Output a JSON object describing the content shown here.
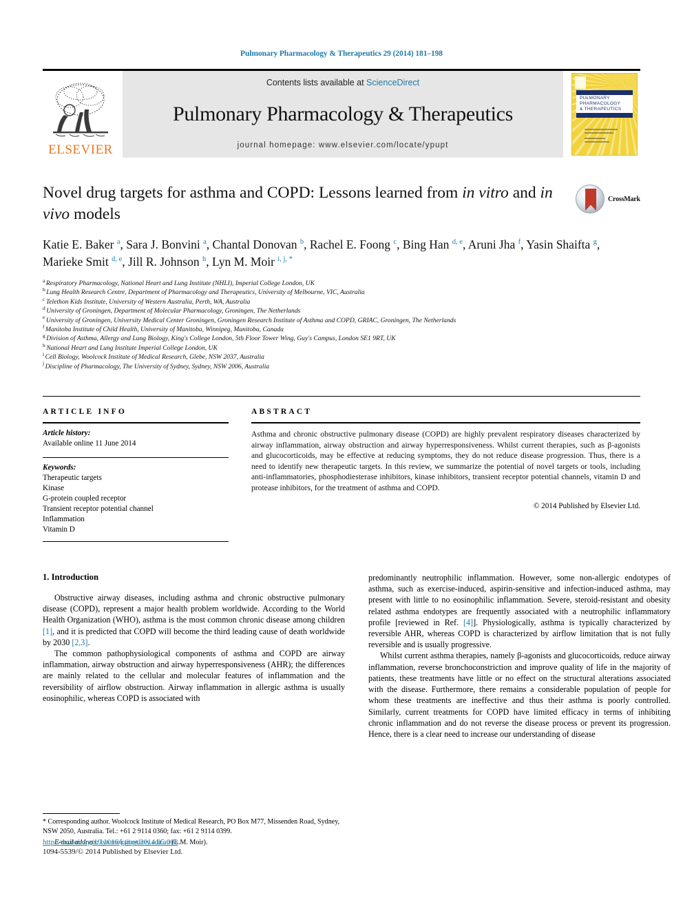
{
  "running_head": "Pulmonary Pharmacology & Therapeutics 29 (2014) 181–198",
  "masthead": {
    "contents_prefix": "Contents lists available at ",
    "sciencedirect": "ScienceDirect",
    "journal_title": "Pulmonary Pharmacology & Therapeutics",
    "homepage": "journal homepage: www.elsevier.com/locate/ypupt",
    "elsevier_wordmark": "ELSEVIER",
    "cover": {
      "line1": "PULMONARY",
      "line2": "PHARMACOLOGY",
      "line3": "& THERAPEUTICS"
    },
    "colors": {
      "link": "#1f7ba8",
      "elsevier_orange": "#e87722",
      "band_gray": "#e6e6e6",
      "cover_yellow": "#f2d33c",
      "cover_navy": "#1b2f6b"
    }
  },
  "article": {
    "title_part1": "Novel drug targets for asthma and COPD: Lessons learned from ",
    "title_italic1": "in vitro",
    "title_part2": " and ",
    "title_italic2": "in vivo",
    "title_part3": " models",
    "crossmark_label": "CrossMark",
    "authors": [
      {
        "name": "Katie E. Baker",
        "sup": "a",
        "sep": ", "
      },
      {
        "name": "Sara J. Bonvini",
        "sup": "a",
        "sep": ", "
      },
      {
        "name": "Chantal Donovan",
        "sup": "b",
        "sep": ", "
      },
      {
        "name": "Rachel E. Foong",
        "sup": "c",
        "sep": ", "
      },
      {
        "name": "Bing Han",
        "sup": "d, e",
        "sep": ", "
      },
      {
        "name": "Aruni Jha",
        "sup": "f",
        "sep": ", "
      },
      {
        "name": "Yasin Shaifta",
        "sup": "g",
        "sep": ", "
      },
      {
        "name": "Marieke Smit",
        "sup": "d, e",
        "sep": ", "
      },
      {
        "name": "Jill R. Johnson",
        "sup": "h",
        "sep": ", "
      },
      {
        "name": "Lyn M. Moir",
        "sup": "i, j, *",
        "sep": ""
      }
    ],
    "affiliations": [
      {
        "mark": "a",
        "text": "Respiratory Pharmacology, National Heart and Lung Institute (NHLI), Imperial College London, UK"
      },
      {
        "mark": "b",
        "text": "Lung Health Research Centre, Department of Pharmacology and Therapeutics, University of Melbourne, VIC, Australia"
      },
      {
        "mark": "c",
        "text": "Telethon Kids Institute, University of Western Australia, Perth, WA, Australia"
      },
      {
        "mark": "d",
        "text": "University of Groningen, Department of Molecular Pharmacology, Groningen, The Netherlands"
      },
      {
        "mark": "e",
        "text": "University of Groningen, University Medical Center Groningen, Groningen Research Institute of Asthma and COPD, GRIAC, Groningen, The Netherlands"
      },
      {
        "mark": "f",
        "text": "Manitoba Institute of Child Health, University of Manitoba, Winnipeg, Manitoba, Canada"
      },
      {
        "mark": "g",
        "text": "Division of Asthma, Allergy and Lung Biology, King's College London, 5th Floor Tower Wing, Guy's Campus, London SE1 9RT, UK"
      },
      {
        "mark": "h",
        "text": "National Heart and Lung Institute Imperial College London, UK"
      },
      {
        "mark": "i",
        "text": "Cell Biology, Woolcock Institute of Medical Research, Glebe, NSW 2037, Australia"
      },
      {
        "mark": "j",
        "text": "Discipline of Pharmacology, The University of Sydney, Sydney, NSW 2006, Australia"
      }
    ]
  },
  "article_info": {
    "heading": "ARTICLE INFO",
    "history_label": "Article history:",
    "history_value": "Available online 11 June 2014",
    "keywords_label": "Keywords:",
    "keywords": [
      "Therapeutic targets",
      "Kinase",
      "G-protein coupled receptor",
      "Transient receptor potential channel",
      "Inflammation",
      "Vitamin D"
    ]
  },
  "abstract": {
    "heading": "ABSTRACT",
    "text": "Asthma and chronic obstructive pulmonary disease (COPD) are highly prevalent respiratory diseases characterized by airway inflammation, airway obstruction and airway hyperresponsiveness. Whilst current therapies, such as β-agonists and glucocorticoids, may be effective at reducing symptoms, they do not reduce disease progression. Thus, there is a need to identify new therapeutic targets. In this review, we summarize the potential of novel targets or tools, including anti-inflammatories, phosphodiesterase inhibitors, kinase inhibitors, transient receptor potential channels, vitamin D and protease inhibitors, for the treatment of asthma and COPD.",
    "copyright": "© 2014 Published by Elsevier Ltd."
  },
  "body": {
    "section_number_title": "1. Introduction",
    "left_paragraphs": [
      {
        "segments": [
          {
            "t": "Obstructive airway diseases, including asthma and chronic obstructive pulmonary disease (COPD), represent a major health problem worldwide. According to the World Health Organization (WHO), asthma is the most common chronic disease among children "
          },
          {
            "t": "[1]",
            "ref": true
          },
          {
            "t": ", and it is predicted that COPD will become the third leading cause of death worldwide by 2030 "
          },
          {
            "t": "[2,3]",
            "ref": true
          },
          {
            "t": "."
          }
        ]
      },
      {
        "segments": [
          {
            "t": "The common pathophysiological components of asthma and COPD are airway inflammation, airway obstruction and airway hyperresponsiveness (AHR); the differences are mainly related to the cellular and molecular features of inflammation and the reversibility of airflow obstruction. Airway inflammation in allergic asthma is usually eosinophilic, whereas COPD is associated with"
          }
        ]
      }
    ],
    "right_paragraphs": [
      {
        "no_indent": true,
        "segments": [
          {
            "t": "predominantly neutrophilic inflammation. However, some non-allergic endotypes of asthma, such as exercise-induced, aspirin-sensitive and infection-induced asthma, may present with little to no eosinophilic inflammation. Severe, steroid-resistant and obesity related asthma endotypes are frequently associated with a neutrophilic inflammatory profile [reviewed in Ref. "
          },
          {
            "t": "[4]",
            "ref": true
          },
          {
            "t": "]. Physiologically, asthma is typically characterized by reversible AHR, whereas COPD is characterized by airflow limitation that is not fully reversible and is usually progressive."
          }
        ]
      },
      {
        "segments": [
          {
            "t": "Whilst current asthma therapies, namely β-agonists and glucocorticoids, reduce airway inflammation, reverse bronchoconstriction and improve quality of life in the majority of patients, these treatments have little or no effect on the structural alterations associated with the disease. Furthermore, there remains a considerable population of people for whom these treatments are ineffective and thus their asthma is poorly controlled. Similarly, current treatments for COPD have limited efficacy in terms of inhibiting chronic inflammation and do not reverse the disease process or prevent its progression. Hence, there is a clear need to increase our understanding of disease"
          }
        ]
      }
    ]
  },
  "footnote": {
    "star": "*",
    "text": " Corresponding author. Woolcock Institute of Medical Research, PO Box M77, Missenden Road, Sydney, NSW 2050, Australia. Tel.: +61 2 9114 0360; fax: +61 2 9114 0399.",
    "email_label": "E-mail address:",
    "email": "lyn.moir@sydney.edu.au",
    "email_suffix": " (L.M. Moir)."
  },
  "imprint": {
    "doi": "http://dx.doi.org/10.1016/j.pupt.2014.05.008",
    "issn_line": "1094-5539/© 2014 Published by Elsevier Ltd."
  }
}
